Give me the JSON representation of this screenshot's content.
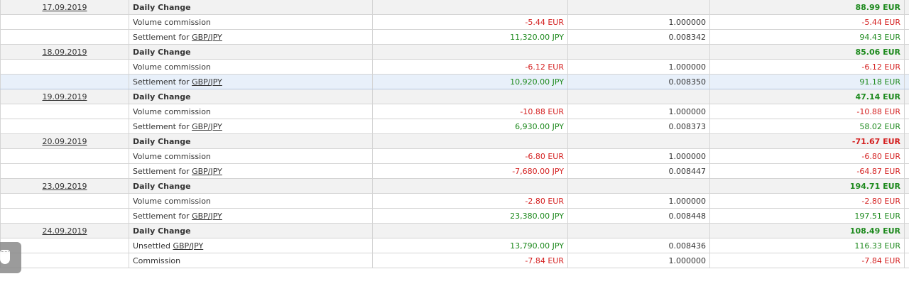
{
  "rows": [
    {
      "type": "daily",
      "date": "17.09.2019",
      "desc": "Daily Change",
      "total": "88.99 EUR",
      "total_sign": "pos"
    },
    {
      "type": "item",
      "desc": "Volume commission",
      "amount": "-5.44 EUR",
      "amount_sign": "neg",
      "rate": "1.000000",
      "total": "-5.44 EUR",
      "total_sign": "neg"
    },
    {
      "type": "settle",
      "desc_prefix": "Settlement for ",
      "pair": "GBP/JPY",
      "amount": "11,320.00 JPY",
      "amount_sign": "pos",
      "rate": "0.008342",
      "total": "94.43 EUR",
      "total_sign": "pos"
    },
    {
      "type": "daily",
      "date": "18.09.2019",
      "desc": "Daily Change",
      "total": "85.06 EUR",
      "total_sign": "pos"
    },
    {
      "type": "item",
      "desc": "Volume commission",
      "amount": "-6.12 EUR",
      "amount_sign": "neg",
      "rate": "1.000000",
      "total": "-6.12 EUR",
      "total_sign": "neg"
    },
    {
      "type": "settle",
      "highlight": true,
      "desc_prefix": "Settlement for ",
      "pair": "GBP/JPY",
      "amount": "10,920.00 JPY",
      "amount_sign": "pos",
      "rate": "0.008350",
      "total": "91.18 EUR",
      "total_sign": "pos"
    },
    {
      "type": "daily",
      "date": "19.09.2019",
      "desc": "Daily Change",
      "total": "47.14 EUR",
      "total_sign": "pos"
    },
    {
      "type": "item",
      "desc": "Volume commission",
      "amount": "-10.88 EUR",
      "amount_sign": "neg",
      "rate": "1.000000",
      "total": "-10.88 EUR",
      "total_sign": "neg"
    },
    {
      "type": "settle",
      "desc_prefix": "Settlement for ",
      "pair": "GBP/JPY",
      "amount": "6,930.00 JPY",
      "amount_sign": "pos",
      "rate": "0.008373",
      "total": "58.02 EUR",
      "total_sign": "pos"
    },
    {
      "type": "daily",
      "date": "20.09.2019",
      "desc": "Daily Change",
      "total": "-71.67 EUR",
      "total_sign": "neg"
    },
    {
      "type": "item",
      "desc": "Volume commission",
      "amount": "-6.80 EUR",
      "amount_sign": "neg",
      "rate": "1.000000",
      "total": "-6.80 EUR",
      "total_sign": "neg"
    },
    {
      "type": "settle",
      "desc_prefix": "Settlement for ",
      "pair": "GBP/JPY",
      "amount": "-7,680.00 JPY",
      "amount_sign": "neg",
      "rate": "0.008447",
      "total": "-64.87 EUR",
      "total_sign": "neg"
    },
    {
      "type": "daily",
      "date": "23.09.2019",
      "desc": "Daily Change",
      "total": "194.71 EUR",
      "total_sign": "pos"
    },
    {
      "type": "item",
      "desc": "Volume commission",
      "amount": "-2.80 EUR",
      "amount_sign": "neg",
      "rate": "1.000000",
      "total": "-2.80 EUR",
      "total_sign": "neg"
    },
    {
      "type": "settle",
      "desc_prefix": "Settlement for ",
      "pair": "GBP/JPY",
      "amount": "23,380.00 JPY",
      "amount_sign": "pos",
      "rate": "0.008448",
      "total": "197.51 EUR",
      "total_sign": "pos"
    },
    {
      "type": "daily",
      "date": "24.09.2019",
      "desc": "Daily Change",
      "total": "108.49 EUR",
      "total_sign": "pos"
    },
    {
      "type": "settle",
      "desc_prefix": "Unsettled ",
      "pair": "GBP/JPY",
      "amount": "13,790.00 JPY",
      "amount_sign": "pos",
      "rate": "0.008436",
      "total": "116.33 EUR",
      "total_sign": "pos"
    },
    {
      "type": "item",
      "desc": "Commission",
      "amount": "-7.84 EUR",
      "amount_sign": "neg",
      "rate": "1.000000",
      "total": "-7.84 EUR",
      "total_sign": "neg"
    }
  ],
  "colors": {
    "positive": "#1e8a1e",
    "negative": "#d42020",
    "row_alt": "#f2f2f2",
    "highlight": "#e8f0fa"
  },
  "overlay": {
    "icon": "chat-bubble-icon"
  }
}
